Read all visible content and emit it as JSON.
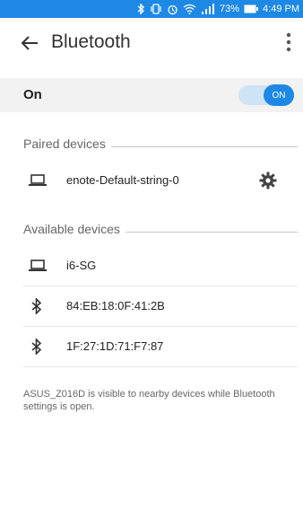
{
  "status_bar": {
    "battery_percent": "73%",
    "time": "4:49 PM",
    "icons": [
      "bluetooth-icon",
      "vibrate-icon",
      "alarm-icon",
      "wifi-icon",
      "signal-icon",
      "battery-icon"
    ],
    "background_color": "#1e88e5"
  },
  "app_bar": {
    "title": "Bluetooth"
  },
  "toggle_row": {
    "label": "On",
    "switch_label": "ON",
    "state": true,
    "accent_color": "#1e88e5"
  },
  "paired": {
    "header": "Paired devices",
    "devices": [
      {
        "name": "enote-Default-string-0",
        "icon": "laptop-icon",
        "action_icon": "gear-icon"
      }
    ]
  },
  "available": {
    "header": "Available devices",
    "devices": [
      {
        "name": "i6-SG",
        "icon": "laptop-icon"
      },
      {
        "name": "84:EB:18:0F:41:2B",
        "icon": "bluetooth-icon"
      },
      {
        "name": "1F:27:1D:71:F7:87",
        "icon": "bluetooth-icon"
      }
    ]
  },
  "footer_text": "ASUS_Z016D is visible to nearby devices while Bluetooth settings is open."
}
